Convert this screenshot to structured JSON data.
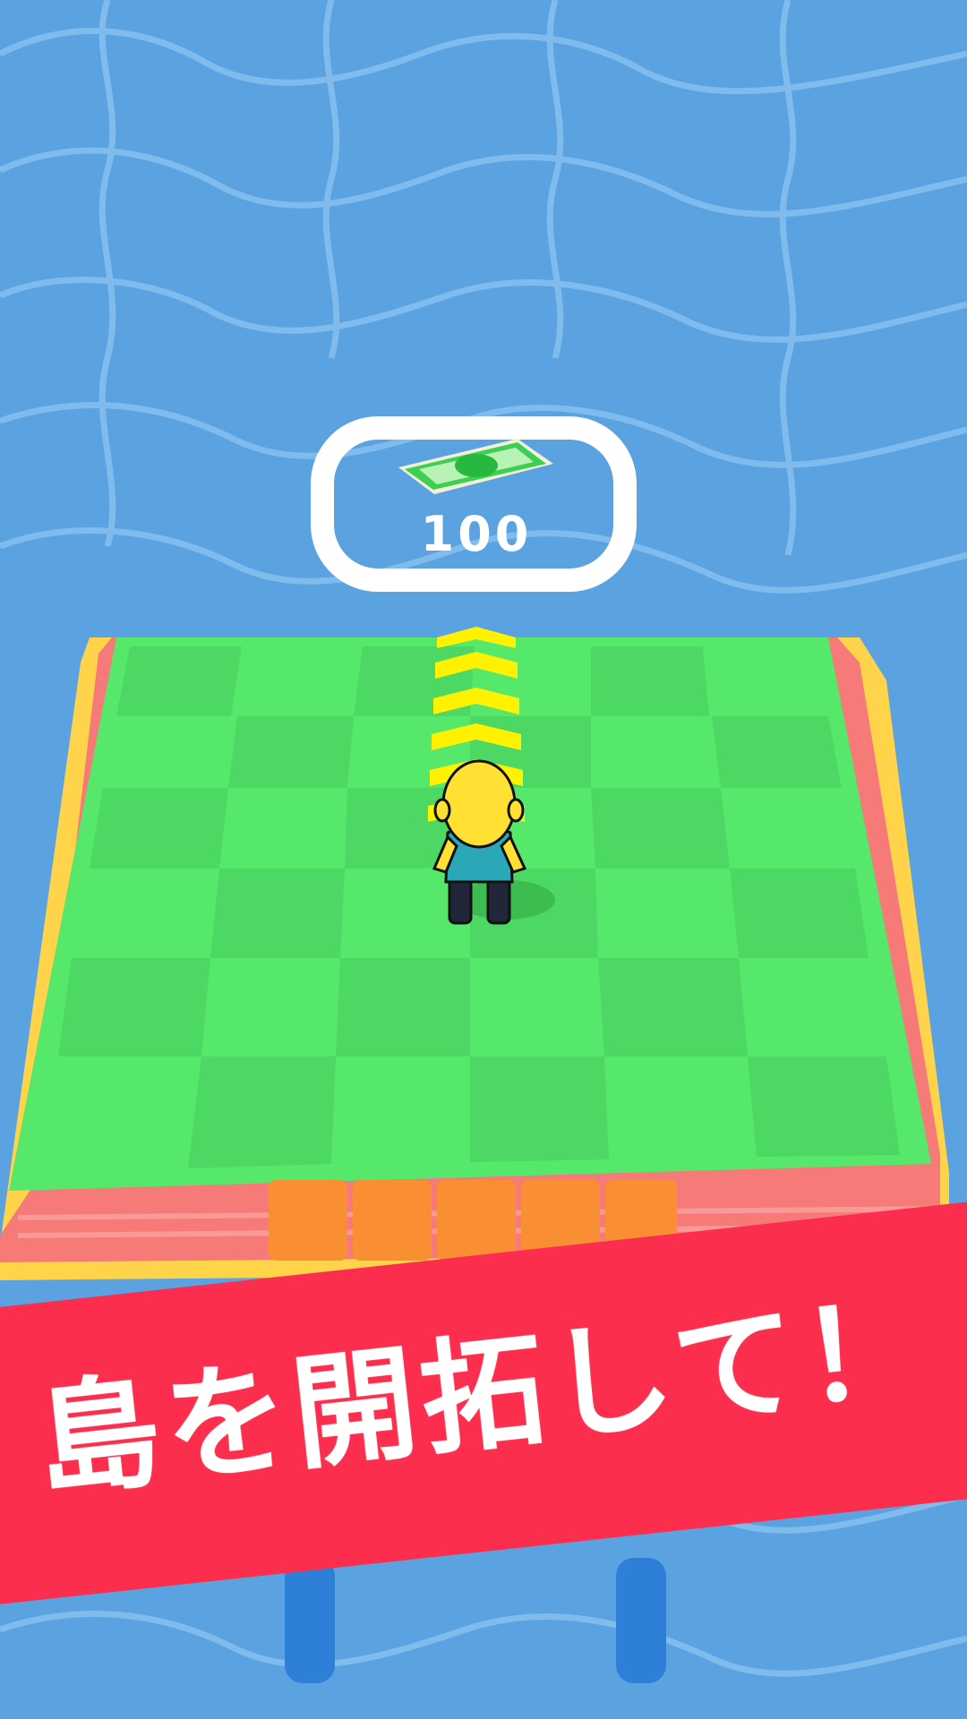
{
  "game": {
    "unlock_cost": "100",
    "unlock_icon": "cash-bill-icon",
    "banner_text": "島を開拓して！"
  },
  "colors": {
    "water": "#5aa3e0",
    "water_lines": "#8cc4f0",
    "grass": "#55e86b",
    "grass_dark": "#4dd863",
    "edge_red": "#f57a78",
    "edge_yellow": "#ffd44a",
    "bridge_orange": "#f98e33",
    "banner_red": "#fc2e4d",
    "arrow_yellow": "#fff200",
    "player_yellow": "#ffe033",
    "player_teal": "#2aa8b8"
  }
}
